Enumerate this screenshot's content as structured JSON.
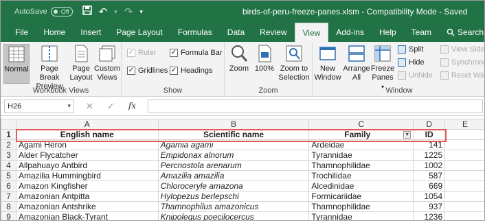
{
  "titlebar": {
    "autosave_label": "AutoSave",
    "autosave_state": "Off",
    "document_title": "birds-of-peru-freeze-panes.xlsm  -  Compatibility Mode  -  Saved"
  },
  "tabs": [
    "File",
    "Home",
    "Insert",
    "Page Layout",
    "Formulas",
    "Data",
    "Review",
    "View",
    "Add-ins",
    "Help",
    "Team"
  ],
  "active_tab": "View",
  "tell_me": "Search",
  "ribbon": {
    "workbook_views": {
      "label": "Workbook Views",
      "normal": "Normal",
      "page_break_1": "Page Break",
      "page_break_2": "Preview",
      "page_layout_1": "Page",
      "page_layout_2": "Layout",
      "custom_1": "Custom",
      "custom_2": "Views"
    },
    "show": {
      "label": "Show",
      "ruler": "Ruler",
      "formula_bar": "Formula Bar",
      "gridlines": "Gridlines",
      "headings": "Headings"
    },
    "zoom": {
      "label": "Zoom",
      "zoom": "Zoom",
      "hundred": "100%",
      "zoom_sel_1": "Zoom to",
      "zoom_sel_2": "Selection"
    },
    "window": {
      "label": "Window",
      "new_window_1": "New",
      "new_window_2": "Window",
      "arrange_1": "Arrange",
      "arrange_2": "All",
      "freeze_1": "Freeze",
      "freeze_2": "Panes",
      "split": "Split",
      "hide": "Hide",
      "unhide": "Unhide",
      "view_side": "View Side",
      "synchronous": "Synchrono",
      "reset_window": "Reset Win"
    }
  },
  "formula_bar": {
    "name_box": "H26",
    "cancel": "✕",
    "enter": "✓",
    "fx": "fx",
    "value": ""
  },
  "grid": {
    "columns": [
      "A",
      "B",
      "C",
      "D",
      "E"
    ],
    "header_row": [
      "English name",
      "Scientific name",
      "Family",
      "ID"
    ],
    "rows": [
      [
        "Agami Heron",
        "Agamia agami",
        "Ardeidae",
        "141"
      ],
      [
        "Alder Flycatcher",
        "Empidonax alnorum",
        "Tyrannidae",
        "1225"
      ],
      [
        "Allpahuayo Antbird",
        "Percnostola arenarum",
        "Thamnophilidae",
        "1002"
      ],
      [
        "Amazilia Hummingbird",
        "Amazilia amazilia",
        "Trochilidae",
        "587"
      ],
      [
        "Amazon Kingfisher",
        "Chloroceryle amazona",
        "Alcedinidae",
        "669"
      ],
      [
        "Amazonian Antpitta",
        "Hylopezus berlepschi",
        "Formicariidae",
        "1054"
      ],
      [
        "Amazonian Antshrike",
        "Thamnophilus amazonicus",
        "Thamnophilidae",
        "937"
      ],
      [
        "Amazonian Black-Tyrant",
        "Knipolegus poecilocercus",
        "Tyrannidae",
        "1236"
      ]
    ]
  }
}
